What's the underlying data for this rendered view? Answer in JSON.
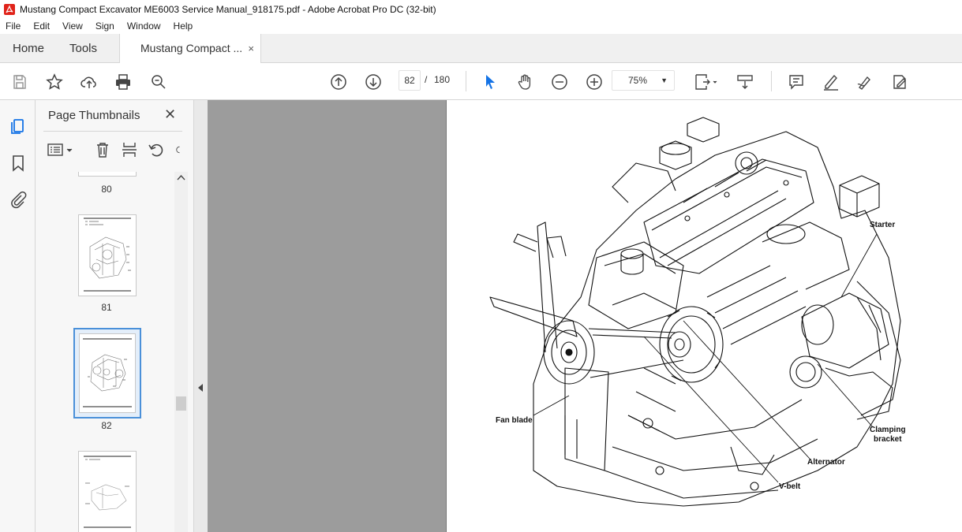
{
  "window": {
    "title": "Mustang Compact Excavator ME6003 Service Manual_918175.pdf - Adobe Acrobat Pro DC (32-bit)"
  },
  "menu": [
    "File",
    "Edit",
    "View",
    "Sign",
    "Window",
    "Help"
  ],
  "tabs": {
    "home": "Home",
    "tools": "Tools",
    "document": "Mustang Compact ...",
    "close": "×"
  },
  "toolbar": {
    "current_page": "82",
    "separator": "/",
    "total_pages": "180",
    "zoom": "75%",
    "zoom_dropdown": "▼"
  },
  "panel": {
    "title": "Page Thumbnails",
    "close": "✕",
    "thumbnails": [
      {
        "label": "80"
      },
      {
        "label": "81"
      },
      {
        "label": "82",
        "selected": true
      },
      {
        "label": ""
      }
    ]
  },
  "drawing": {
    "callouts": {
      "starter": "Starter",
      "fan_blade": "Fan blade",
      "clamping_bracket": "Clamping\nbracket",
      "alternator": "Alternator",
      "vbelt": "V-belt"
    }
  },
  "colors": {
    "accent": "#1473e6",
    "selected_border": "#4a90d9",
    "gray_canvas": "#9c9c9c"
  }
}
